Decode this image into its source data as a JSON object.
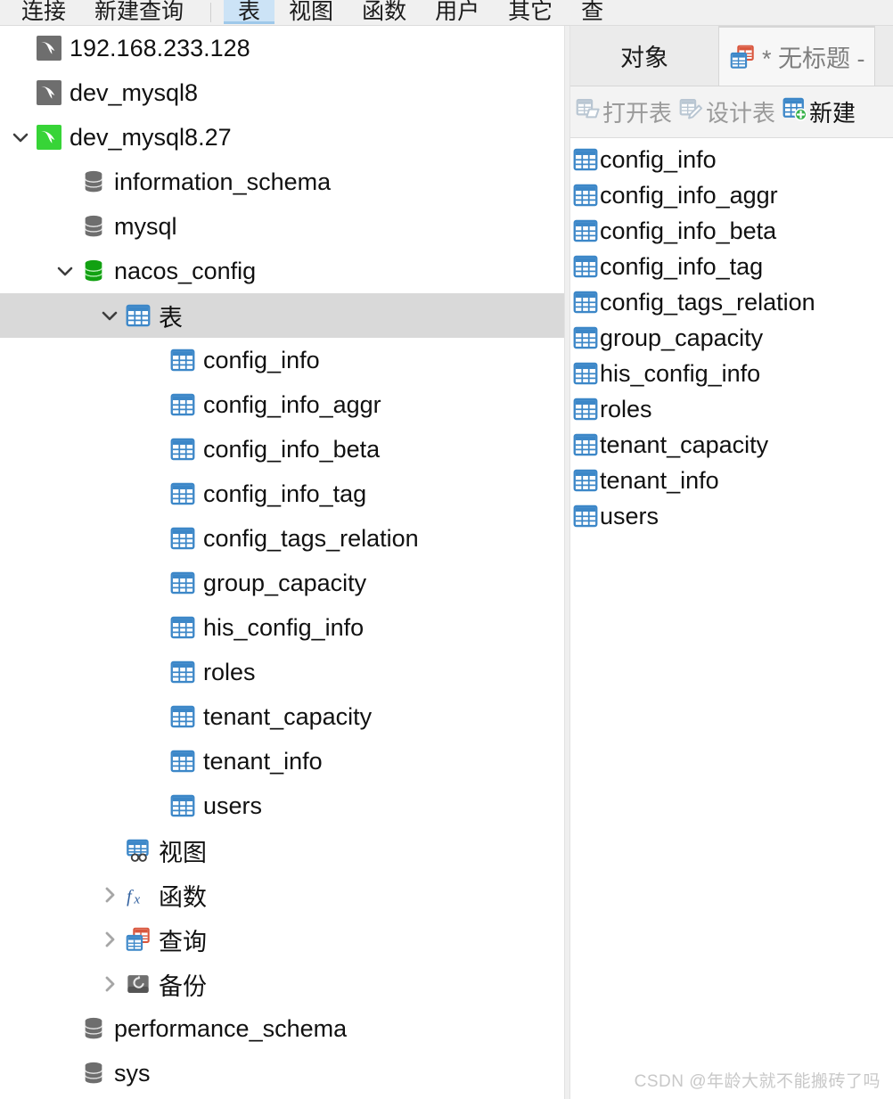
{
  "toolbar": {
    "items": [
      {
        "label": "连接",
        "active": false
      },
      {
        "label": "新建查询",
        "active": false
      },
      {
        "sep": true
      },
      {
        "label": "表",
        "active": true
      },
      {
        "label": "视图",
        "active": false
      },
      {
        "label": "函数",
        "active": false
      },
      {
        "label": "用户",
        "active": false
      },
      {
        "label": "其它",
        "active": false
      },
      {
        "label": "查",
        "active": false
      }
    ]
  },
  "tree": {
    "nodes": [
      {
        "label": "192.168.233.128",
        "icon": "mysql-connection-icon",
        "state": "disconnected",
        "indent": 0,
        "twisty": "none",
        "selected": false
      },
      {
        "label": "dev_mysql8",
        "icon": "mysql-connection-icon",
        "state": "disconnected",
        "indent": 0,
        "twisty": "none",
        "selected": false
      },
      {
        "label": "dev_mysql8.27",
        "icon": "mysql-connection-icon",
        "state": "connected",
        "indent": 0,
        "twisty": "expanded",
        "selected": false
      },
      {
        "label": "information_schema",
        "icon": "database-icon",
        "state": "closed",
        "indent": 1,
        "twisty": "none",
        "selected": false
      },
      {
        "label": "mysql",
        "icon": "database-icon",
        "state": "closed",
        "indent": 1,
        "twisty": "none",
        "selected": false
      },
      {
        "label": "nacos_config",
        "icon": "database-icon",
        "state": "open",
        "indent": 1,
        "twisty": "expanded",
        "selected": false
      },
      {
        "label": "表",
        "icon": "table-folder-icon",
        "state": "",
        "indent": 2,
        "twisty": "expanded",
        "selected": true
      },
      {
        "label": "config_info",
        "icon": "table-icon",
        "state": "",
        "indent": 3,
        "twisty": "none",
        "selected": false
      },
      {
        "label": "config_info_aggr",
        "icon": "table-icon",
        "state": "",
        "indent": 3,
        "twisty": "none",
        "selected": false
      },
      {
        "label": "config_info_beta",
        "icon": "table-icon",
        "state": "",
        "indent": 3,
        "twisty": "none",
        "selected": false
      },
      {
        "label": "config_info_tag",
        "icon": "table-icon",
        "state": "",
        "indent": 3,
        "twisty": "none",
        "selected": false
      },
      {
        "label": "config_tags_relation",
        "icon": "table-icon",
        "state": "",
        "indent": 3,
        "twisty": "none",
        "selected": false
      },
      {
        "label": "group_capacity",
        "icon": "table-icon",
        "state": "",
        "indent": 3,
        "twisty": "none",
        "selected": false
      },
      {
        "label": "his_config_info",
        "icon": "table-icon",
        "state": "",
        "indent": 3,
        "twisty": "none",
        "selected": false
      },
      {
        "label": "roles",
        "icon": "table-icon",
        "state": "",
        "indent": 3,
        "twisty": "none",
        "selected": false
      },
      {
        "label": "tenant_capacity",
        "icon": "table-icon",
        "state": "",
        "indent": 3,
        "twisty": "none",
        "selected": false
      },
      {
        "label": "tenant_info",
        "icon": "table-icon",
        "state": "",
        "indent": 3,
        "twisty": "none",
        "selected": false
      },
      {
        "label": "users",
        "icon": "table-icon",
        "state": "",
        "indent": 3,
        "twisty": "none",
        "selected": false
      },
      {
        "label": "视图",
        "icon": "view-icon",
        "state": "",
        "indent": 2,
        "twisty": "none",
        "selected": false
      },
      {
        "label": "函数",
        "icon": "function-icon",
        "state": "",
        "indent": 2,
        "twisty": "collapsed",
        "selected": false
      },
      {
        "label": "查询",
        "icon": "query-icon",
        "state": "",
        "indent": 2,
        "twisty": "collapsed",
        "selected": false
      },
      {
        "label": "备份",
        "icon": "backup-icon",
        "state": "",
        "indent": 2,
        "twisty": "collapsed",
        "selected": false
      },
      {
        "label": "performance_schema",
        "icon": "database-icon",
        "state": "closed",
        "indent": 1,
        "twisty": "none",
        "selected": false
      },
      {
        "label": "sys",
        "icon": "database-icon",
        "state": "closed",
        "indent": 1,
        "twisty": "none",
        "selected": false
      }
    ]
  },
  "right": {
    "tabs": [
      {
        "label": "对象",
        "active": false,
        "icon": null
      },
      {
        "label": "* 无标题 -",
        "active": true,
        "icon": "query-icon"
      }
    ],
    "object_toolbar": [
      {
        "label": "打开表",
        "icon": "open-table-icon",
        "enabled": false
      },
      {
        "label": "设计表",
        "icon": "design-table-icon",
        "enabled": false
      },
      {
        "label": "新建",
        "icon": "new-table-icon",
        "enabled": true
      }
    ],
    "tables": [
      "config_info",
      "config_info_aggr",
      "config_info_beta",
      "config_info_tag",
      "config_tags_relation",
      "group_capacity",
      "his_config_info",
      "roles",
      "tenant_capacity",
      "tenant_info",
      "users"
    ]
  },
  "watermark": {
    "text": "CSDN @年龄大就不能搬砖了吗"
  },
  "colors": {
    "accent_blue": "#3c87c8",
    "active_tab_bg": "#cce3f6",
    "connected_green": "#37d437",
    "selected_row": "#d9d9d9",
    "toolbar_bg": "#f0f0f0"
  }
}
